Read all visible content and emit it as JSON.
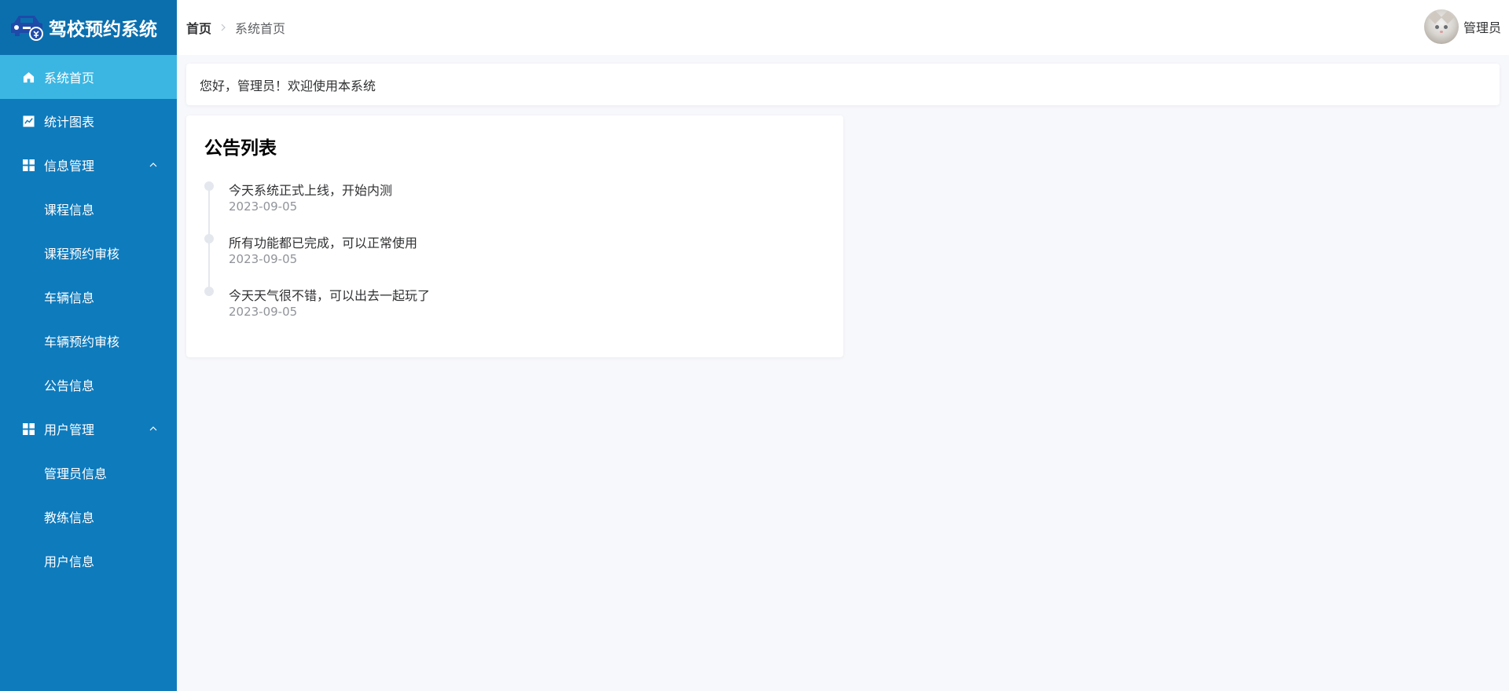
{
  "app": {
    "title": "驾校预约系统"
  },
  "sidebar": {
    "items": [
      {
        "label": "系统首页",
        "icon": "home-icon",
        "active": true
      },
      {
        "label": "统计图表",
        "icon": "chart-icon"
      },
      {
        "label": "信息管理",
        "icon": "grid-icon",
        "expanded": true,
        "children": [
          "课程信息",
          "课程预约审核",
          "车辆信息",
          "车辆预约审核",
          "公告信息"
        ]
      },
      {
        "label": "用户管理",
        "icon": "grid-icon",
        "expanded": true,
        "children": [
          "管理员信息",
          "教练信息",
          "用户信息"
        ]
      }
    ]
  },
  "header": {
    "breadcrumb_home": "首页",
    "breadcrumb_current": "系统首页",
    "username": "管理员"
  },
  "welcome": {
    "text": "您好，管理员！欢迎使用本系统"
  },
  "notices": {
    "title": "公告列表",
    "items": [
      {
        "content": "今天系统正式上线，开始内测",
        "date": "2023-09-05"
      },
      {
        "content": "所有功能都已完成，可以正常使用",
        "date": "2023-09-05"
      },
      {
        "content": "今天天气很不错，可以出去一起玩了",
        "date": "2023-09-05"
      }
    ]
  },
  "colors": {
    "sidebar_bg": "#0e7bbd",
    "logo_bg": "#0b6fae",
    "active_item_bg": "#3bb6e3",
    "page_bg": "#f7f8fc"
  }
}
